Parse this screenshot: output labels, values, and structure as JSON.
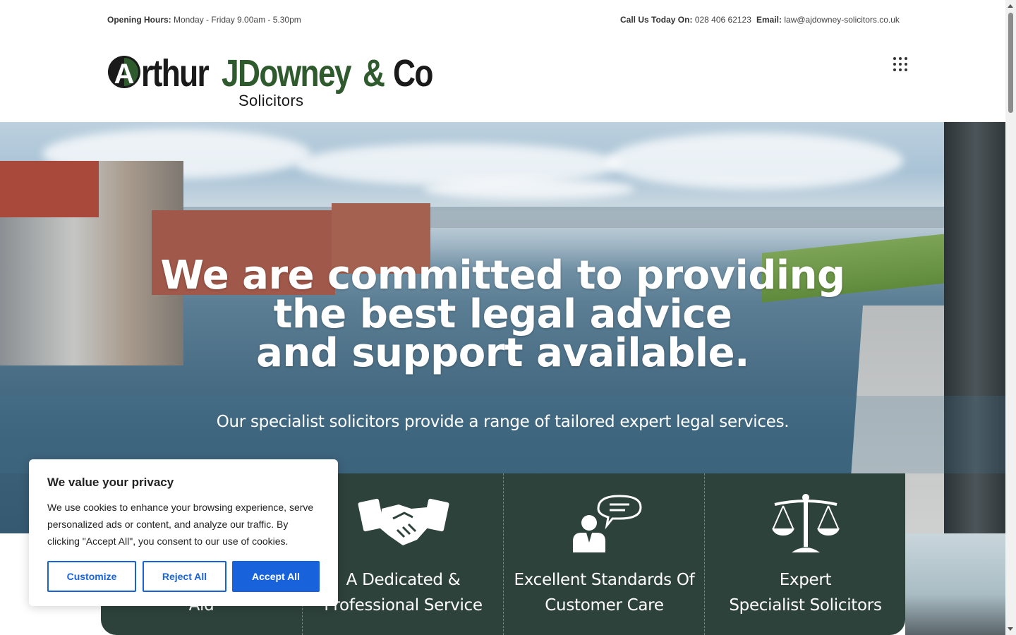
{
  "topbar": {
    "hours_label": "Opening Hours:",
    "hours_value": "Monday - Friday 9.00am - 5.30pm",
    "phone_label": "Call Us Today On:",
    "phone_value": "028 406 62123",
    "email_label": "Email:",
    "email_value": "law@ajdowney-solicitors.co.uk"
  },
  "logo": {
    "word1": "rthur",
    "word2": "JDowney",
    "word3": "&",
    "word4": "Co",
    "subtitle": "Solicitors",
    "mark_letter": "A",
    "colors": {
      "dark": "#1a1a1a",
      "green": "#2f5a2e"
    }
  },
  "header": {
    "menu_icon": "grid-menu-icon"
  },
  "hero": {
    "headline_line1": "We are committed to providing",
    "headline_line2": "the best legal advice",
    "headline_line3": "and support available.",
    "subheading": "Our specialist solicitors provide a range of tailored expert legal services."
  },
  "features": [
    {
      "label_line1": "",
      "label_line2": "Aid",
      "icon": "legal-aid-icon"
    },
    {
      "label_line1": "A Dedicated &",
      "label_line2": "Professional Service",
      "icon": "handshake-icon"
    },
    {
      "label_line1": "Excellent Standards Of",
      "label_line2": "Customer Care",
      "icon": "consultant-chat-icon"
    },
    {
      "label_line1": "Expert",
      "label_line2": "Specialist Solicitors",
      "icon": "scales-icon"
    }
  ],
  "cookie": {
    "title": "We value your privacy",
    "body": "We use cookies to enhance your browsing experience, serve personalized ads or content, and analyze our traffic. By clicking \"Accept All\", you consent to our use of cookies.",
    "customize": "Customize",
    "reject": "Reject All",
    "accept": "Accept All",
    "accent": "#1863dc"
  },
  "colors": {
    "feature_bg": "#2d423b",
    "text_white": "#ffffff"
  }
}
